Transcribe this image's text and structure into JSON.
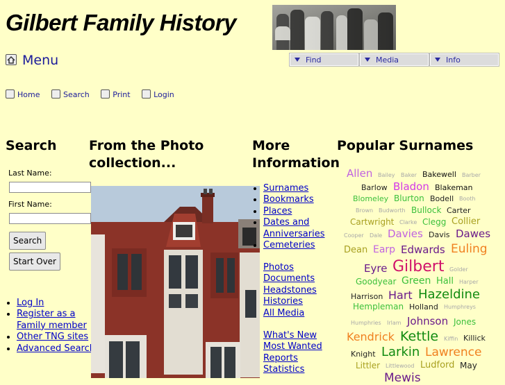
{
  "header": {
    "site_title": "Gilbert Family History",
    "menus": [
      "Find",
      "Media",
      "Info"
    ]
  },
  "menu_link": "Menu",
  "topnav": [
    "Home",
    "Search",
    "Print",
    "Login"
  ],
  "search": {
    "heading": "Search",
    "last_name_label": "Last Name:",
    "first_name_label": "First Name:",
    "search_button": "Search",
    "start_over_button": "Start Over",
    "links": [
      "Log In",
      "Register as a Family member",
      "Other TNG sites",
      "Advanced Search"
    ]
  },
  "photo": {
    "heading": "From the Photo collection..."
  },
  "more_info": {
    "heading": "More Information",
    "group1": [
      "Surnames",
      "Bookmarks",
      "Places",
      "Dates and Anniversaries",
      "Cemeteries"
    ],
    "group2": [
      "Photos",
      "Documents",
      "Headstones",
      "Histories",
      "All Media"
    ],
    "group3": [
      "What's New",
      "Most Wanted",
      "Reports",
      "Statistics"
    ]
  },
  "surnames": {
    "heading": "Popular Surnames",
    "rows": [
      [
        {
          "n": "Allen",
          "c": "#c062e0",
          "s": 15
        },
        {
          "n": "Bailey",
          "c": "#a8a8a8",
          "s": 8
        },
        {
          "n": "Baker",
          "c": "#a8a8a8",
          "s": 8
        },
        {
          "n": "Bakewell",
          "c": "#111111",
          "s": 11
        },
        {
          "n": "Barber",
          "c": "#a8a8a8",
          "s": 8
        }
      ],
      [
        {
          "n": "Barlow",
          "c": "#222222",
          "s": 11
        },
        {
          "n": "Bladon",
          "c": "#d238e8",
          "s": 15
        },
        {
          "n": "Blakeman",
          "c": "#111111",
          "s": 11
        }
      ],
      [
        {
          "n": "Blomeley",
          "c": "#3cc03c",
          "s": 11
        },
        {
          "n": "Blurton",
          "c": "#3cc03c",
          "s": 12
        },
        {
          "n": "Bodell",
          "c": "#222222",
          "s": 11
        },
        {
          "n": "Booth",
          "c": "#a8a8a8",
          "s": 8
        }
      ],
      [
        {
          "n": "Brown",
          "c": "#a8a8a8",
          "s": 8
        },
        {
          "n": "Budworth",
          "c": "#a8a8a8",
          "s": 8
        },
        {
          "n": "Bullock",
          "c": "#3cc03c",
          "s": 12
        },
        {
          "n": "Carter",
          "c": "#222222",
          "s": 11
        }
      ],
      [
        {
          "n": "Cartwright",
          "c": "#a8a020",
          "s": 12
        },
        {
          "n": "Clarke",
          "c": "#a8a8a8",
          "s": 8
        },
        {
          "n": "Clegg",
          "c": "#3cc03c",
          "s": 12
        },
        {
          "n": "Collier",
          "c": "#a8a020",
          "s": 13
        }
      ],
      [
        {
          "n": "Cooper",
          "c": "#a8a8a8",
          "s": 8
        },
        {
          "n": "Dale",
          "c": "#a8a8a8",
          "s": 8
        },
        {
          "n": "Davies",
          "c": "#c062e0",
          "s": 15
        },
        {
          "n": "Davis",
          "c": "#222222",
          "s": 11
        },
        {
          "n": "Dawes",
          "c": "#6a1a8a",
          "s": 15
        }
      ],
      [
        {
          "n": "Dean",
          "c": "#a8a020",
          "s": 13
        },
        {
          "n": "Earp",
          "c": "#c062e0",
          "s": 14
        },
        {
          "n": "Edwards",
          "c": "#6a1a8a",
          "s": 15
        },
        {
          "n": "Euling",
          "c": "#f08020",
          "s": 17
        }
      ],
      [
        {
          "n": "Eyre",
          "c": "#6a1a8a",
          "s": 15
        },
        {
          "n": "Gilbert",
          "c": "#d0106a",
          "s": 22
        },
        {
          "n": "Golder",
          "c": "#a8a8a8",
          "s": 8
        }
      ],
      [
        {
          "n": "Goodyear",
          "c": "#3cc03c",
          "s": 12
        },
        {
          "n": "Green",
          "c": "#3cc03c",
          "s": 14
        },
        {
          "n": "Hall",
          "c": "#3cc03c",
          "s": 13
        },
        {
          "n": "Harper",
          "c": "#a8a8a8",
          "s": 8
        }
      ],
      [
        {
          "n": "Harrison",
          "c": "#222222",
          "s": 11
        },
        {
          "n": "Hart",
          "c": "#6a1a8a",
          "s": 16
        },
        {
          "n": "Hazeldine",
          "c": "#108a10",
          "s": 18
        }
      ],
      [
        {
          "n": "Hempleman",
          "c": "#3cc03c",
          "s": 12
        },
        {
          "n": "Holland",
          "c": "#222222",
          "s": 11
        },
        {
          "n": "Humphreys",
          "c": "#a8a8a8",
          "s": 8
        }
      ],
      [
        {
          "n": "Humphries",
          "c": "#a8a8a8",
          "s": 8
        },
        {
          "n": "Irlam",
          "c": "#a8a8a8",
          "s": 8
        },
        {
          "n": "Johnson",
          "c": "#6a1a8a",
          "s": 15
        },
        {
          "n": "Jones",
          "c": "#3cc03c",
          "s": 12
        }
      ],
      [
        {
          "n": "Kendrick",
          "c": "#f08020",
          "s": 16
        },
        {
          "n": "Kettle",
          "c": "#108a10",
          "s": 19
        },
        {
          "n": "Kiffin",
          "c": "#a8a8a8",
          "s": 8
        },
        {
          "n": "Killick",
          "c": "#222222",
          "s": 11
        }
      ],
      [
        {
          "n": "Knight",
          "c": "#222222",
          "s": 11
        },
        {
          "n": "Larkin",
          "c": "#108a10",
          "s": 18
        },
        {
          "n": "Lawrence",
          "c": "#f08020",
          "s": 17
        }
      ],
      [
        {
          "n": "Littler",
          "c": "#a8a020",
          "s": 12
        },
        {
          "n": "Littlewood",
          "c": "#a8a8a8",
          "s": 8
        },
        {
          "n": "Ludford",
          "c": "#a8a020",
          "s": 13
        },
        {
          "n": "May",
          "c": "#222222",
          "s": 12
        }
      ],
      [
        {
          "n": "Mewis",
          "c": "#6a1a8a",
          "s": 17
        }
      ]
    ]
  }
}
